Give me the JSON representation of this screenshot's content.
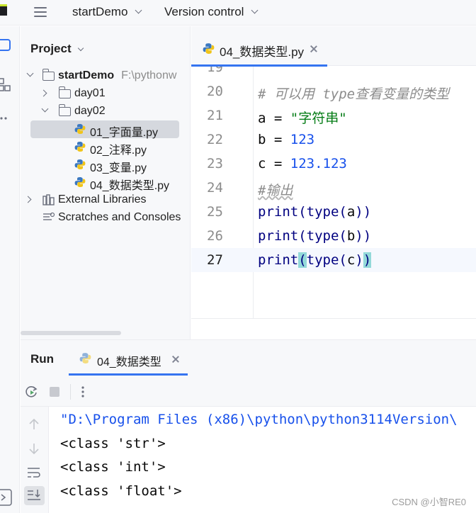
{
  "topbar": {
    "project_name": "startDemo",
    "vcs_label": "Version control"
  },
  "project_panel": {
    "title": "Project",
    "tree": [
      {
        "label": "startDemo",
        "path": "F:\\pythonw",
        "type": "root",
        "expanded": true
      },
      {
        "label": "day01",
        "type": "folder",
        "expanded": false
      },
      {
        "label": "day02",
        "type": "folder",
        "expanded": true
      },
      {
        "label": "01_字面量.py",
        "type": "python-file",
        "selected": true
      },
      {
        "label": "02_注释.py",
        "type": "python-file"
      },
      {
        "label": "03_变量.py",
        "type": "python-file"
      },
      {
        "label": "04_数据类型.py",
        "type": "python-file"
      },
      {
        "label": "External Libraries",
        "type": "libraries"
      },
      {
        "label": "Scratches and Consoles",
        "type": "scratches"
      }
    ]
  },
  "editor": {
    "tab_label": "04_数据类型.py",
    "partial_line_number": "19",
    "lines": [
      {
        "number": "20",
        "text": "# 可以用 type查看变量的类型"
      },
      {
        "number": "21",
        "text": "a = \"字符串\""
      },
      {
        "number": "22",
        "text": "b = 123"
      },
      {
        "number": "23",
        "text": "c = 123.123"
      },
      {
        "number": "24",
        "text": "#输出"
      },
      {
        "number": "25",
        "text": "print(type(a))"
      },
      {
        "number": "26",
        "text": "print(type(b))"
      },
      {
        "number": "27",
        "text": "print(type(c))"
      }
    ],
    "current_line": "27",
    "code_tokens": {
      "l20": "# 可以用 type查看变量的类型",
      "l21_var": "a = ",
      "l21_str": "\"字符串\"",
      "l22_var": "b = ",
      "l22_num": "123",
      "l23_var": "c = ",
      "l23_num": "123.123",
      "l24": "#输出",
      "l25_a": "print(type(",
      "l25_b": "a",
      "l25_c": "))",
      "l26_a": "print(type(",
      "l26_b": "b",
      "l26_c": "))",
      "l27_print": "print",
      "l27_open": "(",
      "l27_type": "type(",
      "l27_var": "c",
      "l27_close1": ")",
      "l27_close2": ")"
    }
  },
  "run_panel": {
    "title": "Run",
    "tab_label": "04_数据类型",
    "output": [
      "\"D:\\Program Files (x86)\\python\\python3114Version\\",
      "<class 'str'>",
      "<class 'int'>",
      "<class 'float'>"
    ]
  },
  "watermark": "CSDN @小智RE0",
  "colors": {
    "accent": "#3574f0",
    "comment": "#8c8c8c",
    "string": "#067d17",
    "number": "#1750eb",
    "bracket_highlight": "#93d9d9"
  },
  "icons": [
    "app-logo-icon",
    "hamburger-menu-icon",
    "chevron-down-icon",
    "folder-icon",
    "python-file-icon",
    "close-icon",
    "rerun-icon",
    "stop-icon",
    "more-icon",
    "arrow-up-icon",
    "arrow-down-icon",
    "wrap-icon",
    "scroll-to-end-icon",
    "library-icon",
    "scratches-icon"
  ]
}
